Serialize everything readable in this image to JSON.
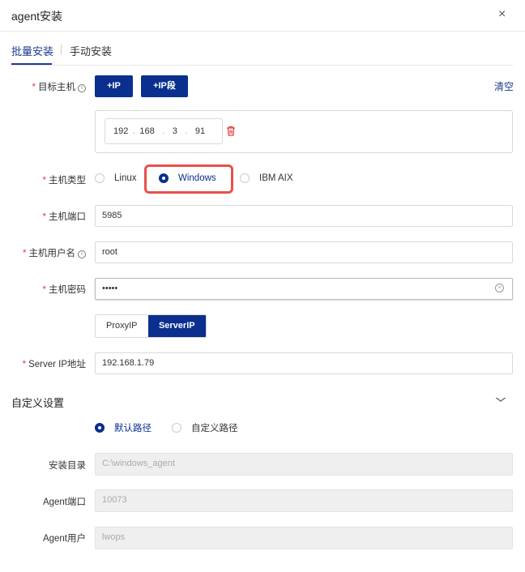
{
  "dialog": {
    "title": "agent安装",
    "close": "×"
  },
  "tabs": [
    {
      "label": "批量安装"
    },
    {
      "label": "手动安装"
    }
  ],
  "target_host": {
    "label": "目标主机",
    "add_ip": "+IP",
    "add_ip_range": "+IP段",
    "clear": "清空",
    "ip": [
      "192",
      "168",
      "3",
      "91"
    ]
  },
  "host_type": {
    "label": "主机类型",
    "options": [
      "Linux",
      "Windows",
      "IBM AIX"
    ],
    "selected": "Windows"
  },
  "host_port": {
    "label": "主机端口",
    "value": "5985"
  },
  "host_user": {
    "label": "主机用户名",
    "value": "root"
  },
  "host_password": {
    "label": "主机密码",
    "value": "•••••"
  },
  "ip_mode": {
    "options": [
      "ProxyIP",
      "ServerIP"
    ],
    "selected": "ServerIP"
  },
  "server_ip": {
    "label": "Server IP地址",
    "value": "192.168.1.79"
  },
  "custom": {
    "title": "自定义设置",
    "path_options": [
      "默认路径",
      "自定义路径"
    ],
    "selected": "默认路径"
  },
  "install_dir": {
    "label": "安装目录",
    "placeholder": "C:\\windows_agent"
  },
  "agent_port": {
    "label": "Agent端口",
    "placeholder": "10073"
  },
  "agent_user": {
    "label": "Agent用户",
    "placeholder": "lwops"
  },
  "colors": {
    "primary": "#0a2f8f",
    "required": "#e5383b",
    "highlight": "#e8514a"
  }
}
